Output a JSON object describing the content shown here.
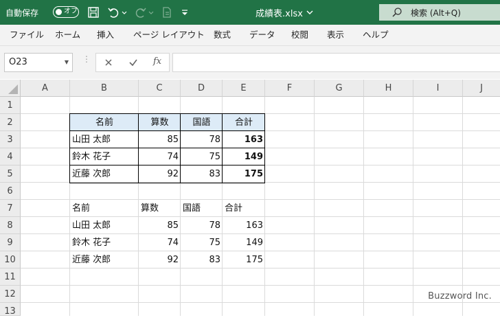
{
  "titlebar": {
    "autosave_label": "自動保存",
    "autosave_state": "オフ",
    "filename": "成績表.xlsx",
    "search_label": "検索 (Alt+Q)",
    "icons": [
      "save-icon",
      "undo-icon",
      "redo-icon",
      "format-painter-icon",
      "customize-icon",
      "search-icon"
    ]
  },
  "ribbon": {
    "tabs": [
      "ファイル",
      "ホーム",
      "挿入",
      "ページ レイアウト",
      "数式",
      "データ",
      "校閲",
      "表示",
      "ヘルプ"
    ]
  },
  "formula_bar": {
    "name_box": "O23",
    "fx": "fx",
    "content": ""
  },
  "grid": {
    "columns": [
      "A",
      "B",
      "C",
      "D",
      "E",
      "F",
      "G",
      "H",
      "I",
      "J"
    ],
    "rows": [
      "1",
      "2",
      "3",
      "4",
      "5",
      "6",
      "7",
      "8",
      "9",
      "10",
      "11",
      "12",
      "13"
    ],
    "table1": {
      "headers": [
        "名前",
        "算数",
        "国語",
        "合計"
      ],
      "rows": [
        [
          "山田 太郎",
          "85",
          "78",
          "163"
        ],
        [
          "鈴木 花子",
          "74",
          "75",
          "149"
        ],
        [
          "近藤 次郎",
          "92",
          "83",
          "175"
        ]
      ],
      "header_fill": "#ddebf7"
    },
    "table2": {
      "headers": [
        "名前",
        "算数",
        "国語",
        "合計"
      ],
      "rows": [
        [
          "山田 太郎",
          "85",
          "78",
          "163"
        ],
        [
          "鈴木 花子",
          "74",
          "75",
          "149"
        ],
        [
          "近藤 次郎",
          "92",
          "83",
          "175"
        ]
      ]
    }
  },
  "watermark": "Buzzword Inc.",
  "colors": {
    "accent": "#217346",
    "header_fill": "#ddebf7"
  }
}
